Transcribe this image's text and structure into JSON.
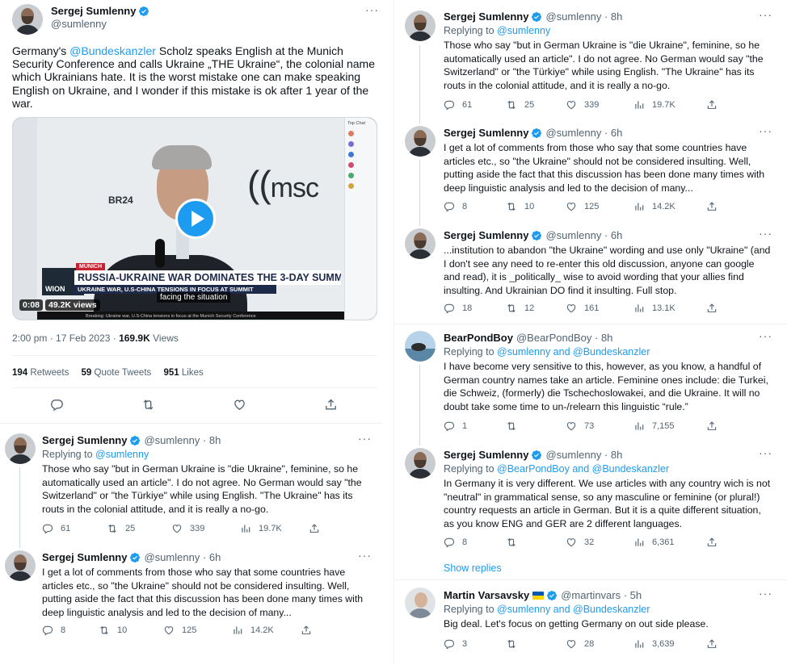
{
  "main_tweet": {
    "author_name": "Sergej Sumlenny",
    "author_handle": "@sumlenny",
    "text_mention": "@Bundeskanzler",
    "text_before": "Germany's ",
    "text_after": " Scholz speaks English at the Munich Security Conference and calls Ukraine „THE Ukraine“, the colonial name which Ukrainians hate. It is the worst mistake one can make speaking English on Ukraine, and I wonder if this mistake is ok after 1 year of the war.",
    "video": {
      "elapsed": "0:08",
      "views": "49.2K views",
      "headline": "RUSSIA-UKRAINE WAR DOMINATES THE 3-DAY SUMMIT",
      "subheadline": "UKRAINE WAR, U.S-CHINA TENSIONS IN FOCUS AT SUMMIT",
      "kicker": "MUNICH",
      "caption": "facing the situation",
      "ticker": "Breaking: Ukraine war, U.S-China tensions in focus at the Munich Security Conference",
      "logo_msc": "msc",
      "logo_br": "BR24",
      "channel": "WION",
      "chat_title": "Top Chat"
    },
    "timestamp": "2:00 pm · 17 Feb 2023 · ",
    "views_count": "169.9K",
    "views_label": " Views",
    "retweets_count": "194",
    "retweets_label": " Retweets",
    "quotes_count": "59",
    "quotes_label": " Quote Tweets",
    "likes_count": "951",
    "likes_label": " Likes"
  },
  "left_replies": [
    {
      "author_name": "Sergej Sumlenny",
      "author_handle": "@sumlenny · 8h",
      "replying_label": "Replying to ",
      "replying_to": "@sumlenny",
      "text": "Those who say \"but in German Ukraine is \"die Ukraine\", feminine, so he automatically used an article\". I do not agree. No German would say \"the Switzerland\" or \"the Türkiye\" while using English. \"The Ukraine\" has its routs in the colonial attitude, and it is really a no-go.",
      "replies": "61",
      "retweets": "25",
      "likes": "339",
      "views": "19.7K"
    },
    {
      "author_name": "Sergej Sumlenny",
      "author_handle": "@sumlenny · 6h",
      "text": "I get a lot of comments from those who say that some countries have articles etc., so \"the Ukraine\" should not be considered insulting. Well, putting aside the fact that this discussion has been done many times with deep linguistic analysis and led to the decision of many...",
      "replies": "8",
      "retweets": "10",
      "likes": "125",
      "views": "14.2K"
    }
  ],
  "right_replies": [
    {
      "author_name": "Sergej Sumlenny",
      "author_handle": "@sumlenny · 8h",
      "replying_label": "Replying to ",
      "replying_to": "@sumlenny",
      "text": "Those who say \"but in German Ukraine is \"die Ukraine\", feminine, so he automatically used an article\". I do not agree. No German would say \"the Switzerland\" or \"the Türkiye\" while using English. \"The Ukraine\" has its routs in the colonial attitude, and it is really a no-go.",
      "replies": "61",
      "retweets": "25",
      "likes": "339",
      "views": "19.7K"
    },
    {
      "author_name": "Sergej Sumlenny",
      "author_handle": "@sumlenny · 6h",
      "text": "I get a lot of comments from those who say that some countries have articles etc., so \"the Ukraine\" should not be considered insulting. Well, putting aside the fact that this discussion has been done many times with deep linguistic analysis and led to the decision of many...",
      "replies": "8",
      "retweets": "10",
      "likes": "125",
      "views": "14.2K"
    },
    {
      "author_name": "Sergej Sumlenny",
      "author_handle": "@sumlenny · 6h",
      "text": "...institution to abandon \"the Ukraine\" wording and use only \"Ukraine\" (and I don't see any need to re-enter this old discussion, anyone can google and read), it is _politically_ wise to avoid wording that your allies find insulting. And Ukrainian DO find it insulting. Full stop.",
      "replies": "18",
      "retweets": "12",
      "likes": "161",
      "views": "13.1K"
    },
    {
      "author_name": "BearPondBoy",
      "author_handle": "@BearPondBoy · 8h",
      "replying_label": "Replying to ",
      "replying_to": "@sumlenny and @Bundeskanzler",
      "text": "I have become very sensitive to this, however, as you know, a handful of German country names take an article. Feminine ones include: die Turkei, die Schweiz, (formerly) die Tschechoslowakei, and die Ukraine. It will no doubt take some time to un-/relearn this linguistic “rule.”",
      "replies": "1",
      "retweets": "",
      "likes": "73",
      "views": "7,155"
    },
    {
      "author_name": "Sergej Sumlenny",
      "author_handle": "@sumlenny · 8h",
      "replying_label": "Replying to ",
      "replying_to": "@BearPondBoy and @Bundeskanzler",
      "text": "In Germany it is very different. We use articles with any country wich is not \"neutral\" in grammatical sense, so any masculine or feminine (or plural!) country requests an article in German. But it is a quite different situation, as you know ENG and GER are 2 different languages.",
      "replies": "8",
      "retweets": "",
      "likes": "32",
      "views": "6,361"
    },
    {
      "author_name": "Martin Varsavsky",
      "author_handle": "@martinvars · 5h",
      "replying_label": "Replying to ",
      "replying_to": "@sumlenny and @Bundeskanzler",
      "text": "Big deal. Let's focus on getting Germany on out side please.",
      "replies": "3",
      "retweets": "",
      "likes": "28",
      "views": "3,639"
    }
  ],
  "show_replies_label": "Show replies",
  "more_label": "···",
  "colors": {
    "accent": "#1d9bf0",
    "secondary_text": "#536471",
    "border": "#eff3f4"
  }
}
